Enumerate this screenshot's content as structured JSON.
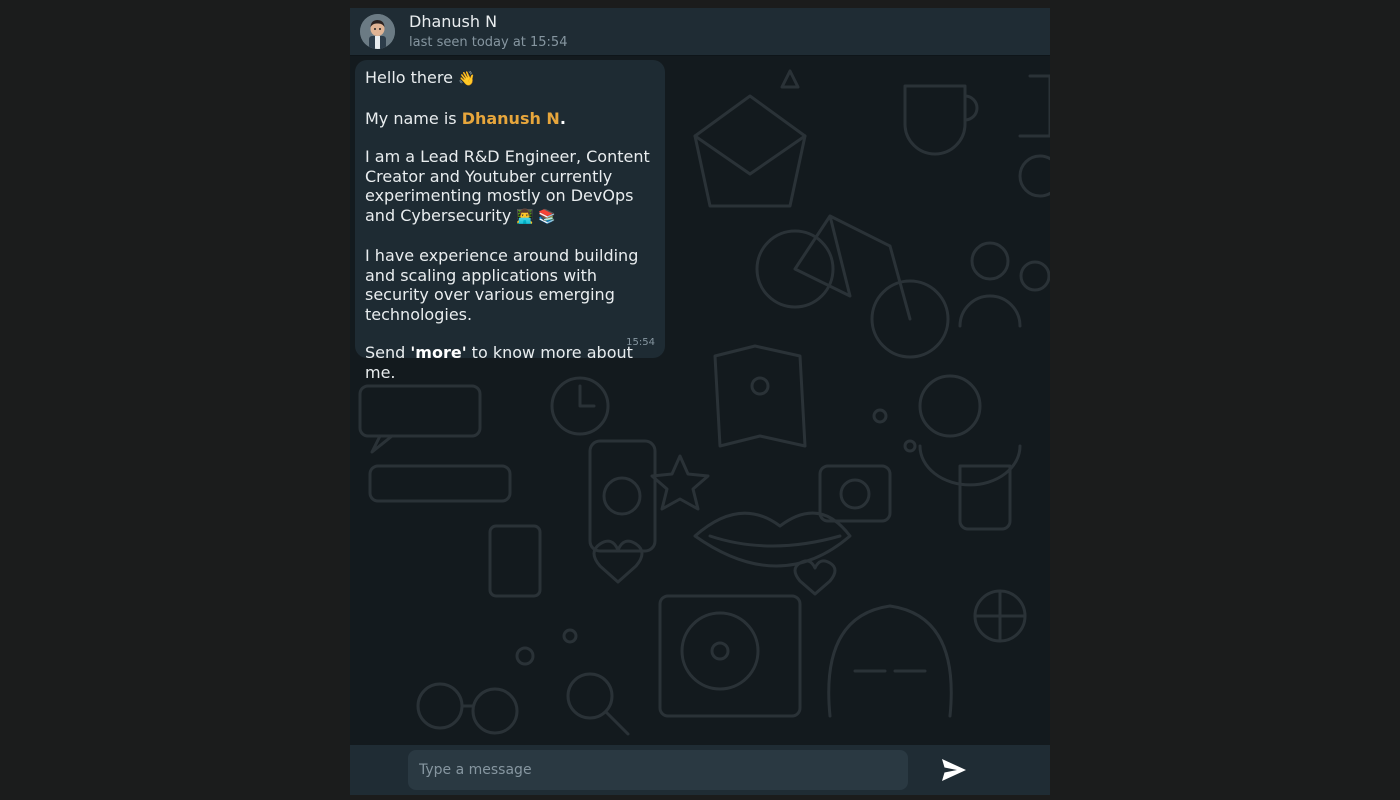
{
  "header": {
    "name": "Dhanush N",
    "status": "last seen today at 15:54"
  },
  "message": {
    "greeting": "Hello there",
    "greeting_emoji": "👋",
    "name_prefix": "My name is ",
    "name": "Dhanush N",
    "name_suffix": ".",
    "bio": "I am a Lead R&D Engineer, Content Creator and Youtuber currently experimenting mostly on DevOps and Cybersecurity",
    "bio_emoji": "👨‍💻 📚",
    "experience": "I have experience around building and scaling applications with security over various emerging technologies.",
    "cta_prefix": "Send ",
    "cta_keyword": "'more'",
    "cta_suffix": " to know more about me.",
    "time": "15:54"
  },
  "composer": {
    "placeholder": "Type a message",
    "value": ""
  },
  "icons": {
    "send": "send-icon",
    "avatar": "avatar"
  },
  "colors": {
    "header_bg": "#1f2c34",
    "bubble_bg": "#1e2b33",
    "name_accent": "#e7a63c",
    "input_bg": "#2a3942"
  }
}
